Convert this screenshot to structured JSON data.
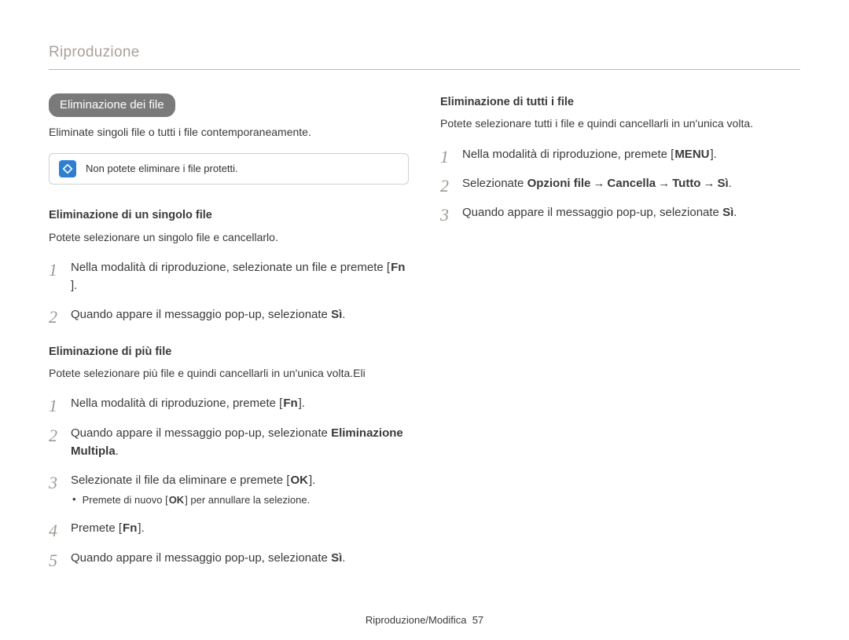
{
  "section_title": "Riproduzione",
  "left": {
    "pill": "Eliminazione dei file",
    "intro": "Eliminate singoli file o tutti i file contemporaneamente.",
    "callout": "Non potete eliminare i file protetti.",
    "single": {
      "head": "Eliminazione di un singolo file",
      "desc": "Potete selezionare un singolo file e cancellarlo.",
      "steps": {
        "s1": {
          "num": "1",
          "text_a": "Nella modalità di riproduzione, selezionate un file e premete [",
          "key": "Fn",
          "text_c": "]."
        },
        "s2": {
          "num": "2",
          "text_a": "Quando appare il messaggio pop-up, selezionate ",
          "bold": "Sì",
          "text_c": "."
        }
      }
    },
    "multi": {
      "head": "Eliminazione di più file",
      "desc": "Potete selezionare più file e quindi cancellarli in un'unica volta.Eli",
      "steps": {
        "s1": {
          "num": "1",
          "text_a": "Nella modalità di riproduzione, premete [",
          "key": "Fn",
          "text_c": "]."
        },
        "s2": {
          "num": "2",
          "text_a": "Quando appare il messaggio pop-up, selezionate ",
          "bold": "Eliminazione Multipla",
          "text_c": "."
        },
        "s3": {
          "num": "3",
          "text_a": "Selezionate il file da eliminare e premete [",
          "key": "OK",
          "text_c": "].",
          "sub_a": "Premete di nuovo [",
          "sub_key": "OK",
          "sub_c": "] per annullare la selezione."
        },
        "s4": {
          "num": "4",
          "text_a": "Premete [",
          "key": "Fn",
          "text_c": "]."
        },
        "s5": {
          "num": "5",
          "text_a": "Quando appare il messaggio pop-up, selezionate ",
          "bold": "Sì",
          "text_c": "."
        }
      }
    }
  },
  "right": {
    "all": {
      "head": "Eliminazione di tutti i file",
      "desc": "Potete selezionare tutti i file e quindi cancellarli in un'unica volta.",
      "steps": {
        "s1": {
          "num": "1",
          "text_a": "Nella modalità di riproduzione, premete [",
          "key": "MENU",
          "text_c": "]."
        },
        "s2": {
          "num": "2",
          "text_a": "Selezionate ",
          "b1": "Opzioni file",
          "arrow": "→",
          "b2": "Cancella",
          "b3": "Tutto",
          "b4": "Sì",
          "text_c": "."
        },
        "s3": {
          "num": "3",
          "text_a": "Quando appare il messaggio pop-up, selezionate ",
          "bold": "Sì",
          "text_c": "."
        }
      }
    }
  },
  "footer": {
    "label": "Riproduzione/Modifica",
    "page": "57"
  }
}
